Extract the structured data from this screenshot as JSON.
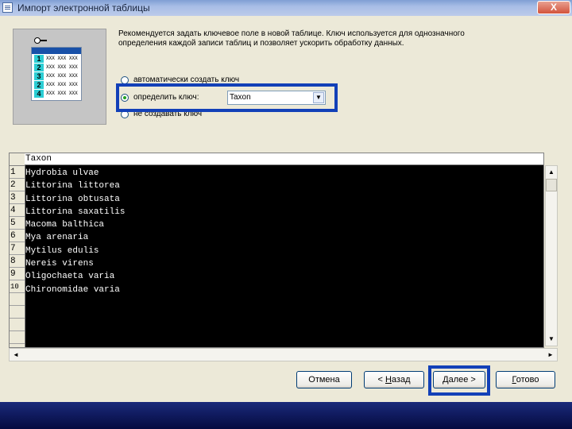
{
  "window": {
    "title": "Импорт электронной таблицы",
    "close_label": "X"
  },
  "illustration": {
    "rows": [
      "1",
      "2",
      "3",
      "2",
      "4"
    ],
    "cell_text": "XXX XXX XXX"
  },
  "description": "Рекомендуется задать ключевое поле в новой таблице.  Ключ используется для однозначного определения каждой записи таблиц и позволяет ускорить обработку данных.",
  "key_options": [
    {
      "label": "автоматически создать ключ",
      "selected": false
    },
    {
      "label": "определить ключ:",
      "selected": true
    },
    {
      "label": "не создавать ключ",
      "selected": false
    }
  ],
  "key_field": {
    "value": "Taxon"
  },
  "grid": {
    "column_header": "Taxon",
    "row_numbers": [
      "1",
      "2",
      "3",
      "4",
      "5",
      "6",
      "7",
      "8",
      "9",
      "10",
      "",
      "",
      "",
      ""
    ],
    "rows": [
      "Hydrobia ulvae",
      "Littorina littorea",
      "Littorina obtusata",
      "Littorina saxatilis",
      "Macoma balthica",
      "Mya arenaria",
      "Mytilus edulis",
      "Nereis virens",
      "Oligochaeta varia",
      "Chironomidae varia"
    ]
  },
  "buttons": {
    "cancel": "Отмена",
    "back_prefix": "< ",
    "back_hotkey": "Н",
    "back_rest": "азад",
    "next_hotkey": "Д",
    "next_rest": "алее >",
    "finish_hotkey": "Г",
    "finish_rest": "отово"
  },
  "colors": {
    "highlight": "#1240b8",
    "grid_background": "#000000",
    "title_bar": "#a8bde6"
  }
}
